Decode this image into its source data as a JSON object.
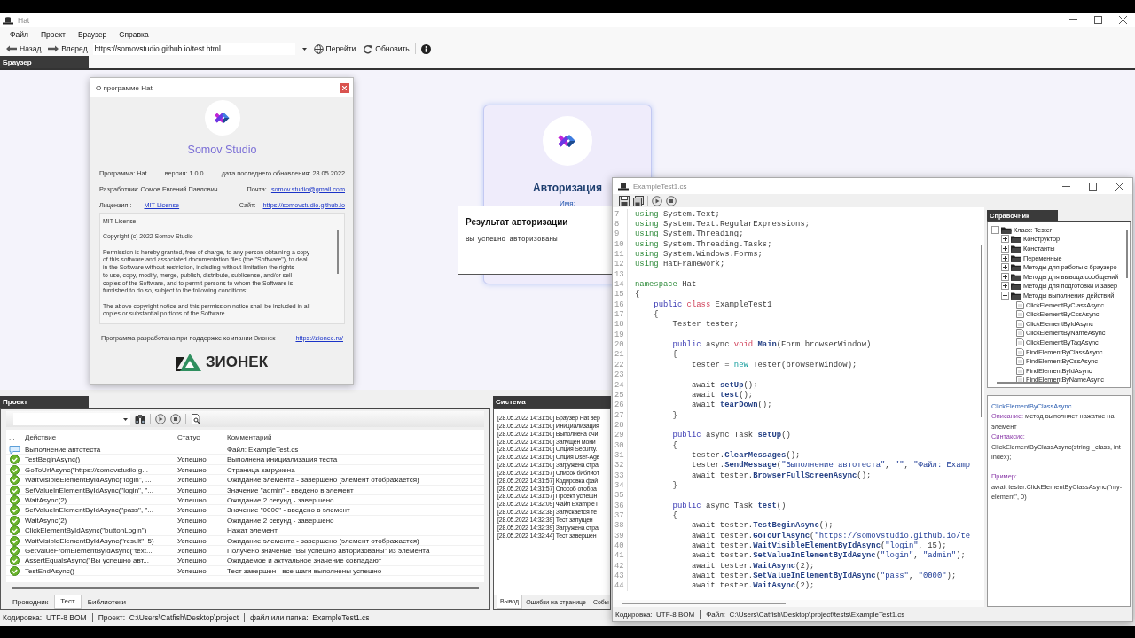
{
  "window": {
    "title": "Hat"
  },
  "menu": [
    "Файл",
    "Проект",
    "Браузер",
    "Справка"
  ],
  "browser_toolbar": {
    "back": "Назад",
    "forward": "Вперед",
    "url": "https://somovstudio.github.io/test.html",
    "go": "Перейти",
    "refresh": "Обновить"
  },
  "browser_tab": "Браузер",
  "web_page": {
    "card_title": "Авторизация",
    "name_label": "Имя:",
    "result_popup": {
      "title": "Результат авторизации",
      "message": "Вы успешно авторизованы"
    }
  },
  "about_dialog": {
    "title": "О программе Hat",
    "studio": "Somov Studio",
    "program": "Программа: Hat",
    "version": "версия: 1.0.0",
    "updated": "дата последнего обновления: 28.05.2022",
    "developer": "Разработчик: Сомов Евгений Павлович",
    "email_label": "Почта:",
    "email": "somov.studio@gmail.com",
    "license_label": "Лицензия :",
    "license": "MIT License",
    "site_label": "Сайт:",
    "site": "https://somovstudio.github.io",
    "license_text": [
      "MIT License",
      "Copyright (c) 2022 Somov Studio",
      "Permission is hereby granted, free of charge, to any person obtaining a copy\nof this software and associated documentation files (the \"Software\"), to deal\nin the Software without restriction, including without limitation the rights\nto use, copy, modify, merge, publish, distribute, sublicense, and/or sell\ncopies of the Software, and to permit persons to whom the Software is\nfurnished to do so, subject to the following conditions:",
      "The above copyright notice and this permission notice shall be included in all\ncopies or substantial portions of the Software."
    ],
    "footer_text": "Программа разработана при поддержке компании Зионек",
    "footer_link": "https://zionec.ru/",
    "sponsor_name": "ЗИОНЕК"
  },
  "project_panel": {
    "title": "Проект",
    "table": {
      "columns": [
        "...",
        "Действие",
        "Статус",
        "Комментарий"
      ],
      "rows": [
        {
          "kind": "message",
          "action": "Выполнение автотеста",
          "comment": "Файл: ExampleTest.cs"
        },
        {
          "kind": "success",
          "action": "TestBeginAsync()",
          "status": "Успешно",
          "comment": "Выполнена инициализация теста"
        },
        {
          "kind": "success",
          "action": "GoToUrlAsync(\"https://somovstudio.g...",
          "status": "Успешно",
          "comment": "Страница загружена"
        },
        {
          "kind": "success",
          "action": "WaitVisibleElementByIdAsync(\"login\", ...",
          "status": "Успешно",
          "comment": "Ожидание элемента - завершено (элемент отображается)"
        },
        {
          "kind": "success",
          "action": "SetValueInElementByIdAsync(\"login\", \"...",
          "status": "Успешно",
          "comment": "Значение \"admin\" - введено в элемент"
        },
        {
          "kind": "success",
          "action": "WaitAsync(2)",
          "status": "Успешно",
          "comment": "Ожидание 2 секунд - завершено"
        },
        {
          "kind": "success",
          "action": "SetValueInElementByIdAsync(\"pass\", \"...",
          "status": "Успешно",
          "comment": "Значение \"0000\" - введено в элемент"
        },
        {
          "kind": "success",
          "action": "WaitAsync(2)",
          "status": "Успешно",
          "comment": "Ожидание 2 секунд - завершено"
        },
        {
          "kind": "success",
          "action": "ClickElementByIdAsync(\"buttonLogin\")",
          "status": "Успешно",
          "comment": "Нажат элемент"
        },
        {
          "kind": "success",
          "action": "WaitVisibleElementByIdAsync(\"result\", 5)",
          "status": "Успешно",
          "comment": "Ожидание элемента - завершено (элемент отображается)"
        },
        {
          "kind": "success",
          "action": "GetValueFromElementByIdAsync(\"text...",
          "status": "Успешно",
          "comment": "Получено значение \"Вы успешно авторизованы\" из элемента"
        },
        {
          "kind": "success",
          "action": "AssertEqualsAsync(\"Вы успешно авт...",
          "status": "Успешно",
          "comment": "Ожидаемое и актуальное значение совпадают"
        },
        {
          "kind": "success",
          "action": "TestEndAsync()",
          "status": "Успешно",
          "comment": "Тест завершен - все шаги выполнены успешно"
        }
      ]
    },
    "tabs": [
      {
        "label": "Проводник",
        "selected": false
      },
      {
        "label": "Тест",
        "selected": true
      },
      {
        "label": "Библиотеки",
        "selected": false
      }
    ]
  },
  "system_panel": {
    "title": "Система",
    "log": [
      "[28.05.2022 14:31:50] Браузер Hat вер",
      "[28.05.2022 14:31:50] Инициализация",
      "[28.05.2022 14:31:50] Выполнена очи",
      "[28.05.2022 14:31:50] Запущен мони",
      "[28.05.2022 14:31:50] Опция Security.",
      "[28.05.2022 14:31:50] Опция User-Age",
      "[28.05.2022 14:31:50] Загружена стра",
      "[28.05.2022 14:31:57] Список библиот",
      "[28.05.2022 14:31:57] Кодировка фай",
      "[28.05.2022 14:31:57] Способ отобра",
      "[28.05.2022 14:31:57] Проект успешн",
      "[28.05.2022 14:32:09] Файл ExampleT",
      "[28.05.2022 14:32:38] Запускается те",
      "[28.05.2022 14:32:39] Тест запущен",
      "[28.05.2022 14:32:39] Загружена стра",
      "[28.05.2022 14:32:44] Тест завершен"
    ],
    "tabs": [
      {
        "label": "Вывод",
        "selected": true
      },
      {
        "label": "Ошибки на странице",
        "selected": false
      },
      {
        "label": "Собы",
        "selected": false
      }
    ]
  },
  "code_window": {
    "title": "ExampleTest1.cs",
    "lines": [
      {
        "number": "7",
        "tokens": [
          {
            "kind": "keyword",
            "text": "using"
          },
          {
            "kind": "text",
            "text": " System.Text;"
          }
        ]
      },
      {
        "number": "8",
        "tokens": [
          {
            "kind": "keyword",
            "text": "using"
          },
          {
            "kind": "text",
            "text": " System.Text.RegularExpressions;"
          }
        ]
      },
      {
        "number": "9",
        "tokens": [
          {
            "kind": "keyword",
            "text": "using"
          },
          {
            "kind": "text",
            "text": " System.Threading;"
          }
        ]
      },
      {
        "number": "10",
        "tokens": [
          {
            "kind": "keyword",
            "text": "using"
          },
          {
            "kind": "text",
            "text": " System.Threading.Tasks;"
          }
        ]
      },
      {
        "number": "11",
        "tokens": [
          {
            "kind": "keyword",
            "text": "using"
          },
          {
            "kind": "text",
            "text": " System.Windows.Forms;"
          }
        ]
      },
      {
        "number": "12",
        "tokens": [
          {
            "kind": "keyword",
            "text": "using"
          },
          {
            "kind": "text",
            "text": " HatFramework;"
          }
        ]
      },
      {
        "number": "13"
      },
      {
        "number": "14",
        "tokens": [
          {
            "kind": "keyword",
            "text": "namespace"
          },
          {
            "kind": "text",
            "text": " Hat"
          }
        ]
      },
      {
        "number": "15",
        "tokens": [
          {
            "kind": "text",
            "text": "{"
          }
        ]
      },
      {
        "number": "16",
        "tokens": [
          {
            "kind": "modifier",
            "text": "    public"
          },
          {
            "kind": "declaration",
            "text": " class"
          },
          {
            "kind": "text",
            "text": " ExampleTest1"
          }
        ]
      },
      {
        "number": "17",
        "tokens": [
          {
            "kind": "text",
            "text": "    {"
          }
        ]
      },
      {
        "number": "18",
        "tokens": [
          {
            "kind": "text",
            "text": "        Tester tester;"
          }
        ]
      },
      {
        "number": "19"
      },
      {
        "number": "20",
        "tokens": [
          {
            "kind": "modifier",
            "text": "        public"
          },
          {
            "kind": "text",
            "text": " async "
          },
          {
            "kind": "declaration",
            "text": "void"
          },
          {
            "kind": "call",
            "text": " Main"
          },
          {
            "kind": "text",
            "text": "(Form browserWindow)"
          }
        ]
      },
      {
        "number": "21",
        "tokens": [
          {
            "kind": "text",
            "text": "        {"
          }
        ]
      },
      {
        "number": "22",
        "tokens": [
          {
            "kind": "text",
            "text": "            tester = "
          },
          {
            "kind": "operator",
            "text": "new"
          },
          {
            "kind": "text",
            "text": " Tester(browserWindow);"
          }
        ]
      },
      {
        "number": "23"
      },
      {
        "number": "24",
        "tokens": [
          {
            "kind": "text",
            "text": "            await "
          },
          {
            "kind": "call",
            "text": "setUp"
          },
          {
            "kind": "text",
            "text": "();"
          }
        ]
      },
      {
        "number": "25",
        "tokens": [
          {
            "kind": "text",
            "text": "            await "
          },
          {
            "kind": "call",
            "text": "test"
          },
          {
            "kind": "text",
            "text": "();"
          }
        ]
      },
      {
        "number": "26",
        "tokens": [
          {
            "kind": "text",
            "text": "            await "
          },
          {
            "kind": "call",
            "text": "tearDown"
          },
          {
            "kind": "text",
            "text": "();"
          }
        ]
      },
      {
        "number": "27",
        "tokens": [
          {
            "kind": "text",
            "text": "        }"
          }
        ]
      },
      {
        "number": "28"
      },
      {
        "number": "29",
        "tokens": [
          {
            "kind": "modifier",
            "text": "        public"
          },
          {
            "kind": "text",
            "text": " async Task "
          },
          {
            "kind": "call",
            "text": "setUp"
          },
          {
            "kind": "text",
            "text": "()"
          }
        ]
      },
      {
        "number": "30",
        "tokens": [
          {
            "kind": "text",
            "text": "        {"
          }
        ]
      },
      {
        "number": "31",
        "tokens": [
          {
            "kind": "text",
            "text": "            tester."
          },
          {
            "kind": "call",
            "text": "ClearMessages"
          },
          {
            "kind": "text",
            "text": "();"
          }
        ]
      },
      {
        "number": "32",
        "tokens": [
          {
            "kind": "text",
            "text": "            tester."
          },
          {
            "kind": "call",
            "text": "SendMessage"
          },
          {
            "kind": "text",
            "text": "("
          },
          {
            "kind": "string",
            "text": "\"Выполнение автотеста\""
          },
          {
            "kind": "text",
            "text": ", "
          },
          {
            "kind": "string",
            "text": "\"\""
          },
          {
            "kind": "text",
            "text": ", "
          },
          {
            "kind": "string",
            "text": "\"Файл: Examp"
          }
        ]
      },
      {
        "number": "33",
        "tokens": [
          {
            "kind": "text",
            "text": "            await tester."
          },
          {
            "kind": "call",
            "text": "BrowserFullScreenAsync"
          },
          {
            "kind": "text",
            "text": "();"
          }
        ]
      },
      {
        "number": "34",
        "tokens": [
          {
            "kind": "text",
            "text": "        }"
          }
        ]
      },
      {
        "number": "35"
      },
      {
        "number": "36",
        "tokens": [
          {
            "kind": "modifier",
            "text": "        public"
          },
          {
            "kind": "text",
            "text": " async Task "
          },
          {
            "kind": "call",
            "text": "test"
          },
          {
            "kind": "text",
            "text": "()"
          }
        ]
      },
      {
        "number": "37",
        "tokens": [
          {
            "kind": "text",
            "text": "        {"
          }
        ]
      },
      {
        "number": "38",
        "tokens": [
          {
            "kind": "text",
            "text": "            await tester."
          },
          {
            "kind": "call",
            "text": "TestBeginAsync"
          },
          {
            "kind": "text",
            "text": "();"
          }
        ]
      },
      {
        "number": "39",
        "tokens": [
          {
            "kind": "text",
            "text": "            await tester."
          },
          {
            "kind": "call",
            "text": "GoToUrlAsync"
          },
          {
            "kind": "text",
            "text": "("
          },
          {
            "kind": "string",
            "text": "\"https://somovstudio.github.io/te"
          }
        ]
      },
      {
        "number": "40",
        "tokens": [
          {
            "kind": "text",
            "text": "            await tester."
          },
          {
            "kind": "call",
            "text": "WaitVisibleElementByIdAsync"
          },
          {
            "kind": "text",
            "text": "("
          },
          {
            "kind": "string",
            "text": "\"login\""
          },
          {
            "kind": "text",
            "text": ", 15);"
          }
        ]
      },
      {
        "number": "41",
        "tokens": [
          {
            "kind": "text",
            "text": "            await tester."
          },
          {
            "kind": "call",
            "text": "SetValueInElementByIdAsync"
          },
          {
            "kind": "text",
            "text": "("
          },
          {
            "kind": "string",
            "text": "\"login\""
          },
          {
            "kind": "text",
            "text": ", "
          },
          {
            "kind": "string",
            "text": "\"admin\""
          },
          {
            "kind": "text",
            "text": ");"
          }
        ]
      },
      {
        "number": "42",
        "tokens": [
          {
            "kind": "text",
            "text": "            await tester."
          },
          {
            "kind": "call",
            "text": "WaitAsync"
          },
          {
            "kind": "text",
            "text": "(2);"
          }
        ]
      },
      {
        "number": "43",
        "tokens": [
          {
            "kind": "text",
            "text": "            await tester."
          },
          {
            "kind": "call",
            "text": "SetValueInElementByIdAsync"
          },
          {
            "kind": "text",
            "text": "("
          },
          {
            "kind": "string",
            "text": "\"pass\""
          },
          {
            "kind": "text",
            "text": ", "
          },
          {
            "kind": "string",
            "text": "\"0000\""
          },
          {
            "kind": "text",
            "text": ");"
          }
        ]
      },
      {
        "number": "44",
        "tokens": [
          {
            "kind": "text",
            "text": "            await tester."
          },
          {
            "kind": "call",
            "text": "WaitAsync"
          },
          {
            "kind": "text",
            "text": "(2);"
          }
        ]
      }
    ],
    "reference": {
      "title": "Справочник",
      "tree": [
        {
          "kind": "folder",
          "label": "Класс: Tester",
          "expanded": true,
          "children": [
            {
              "kind": "folder",
              "label": "Конструктор",
              "expanded": false
            },
            {
              "kind": "folder",
              "label": "Константы",
              "expanded": false
            },
            {
              "kind": "folder",
              "label": "Переменные",
              "expanded": false
            },
            {
              "kind": "folder",
              "label": "Методы для работы с браузеро",
              "expanded": false
            },
            {
              "kind": "folder",
              "label": "Методы для вывода сообщений",
              "expanded": false
            },
            {
              "kind": "folder",
              "label": "Методы для подготовки и завер",
              "expanded": false
            },
            {
              "kind": "folder",
              "label": "Методы выполнения действий",
              "expanded": true,
              "children": [
                {
                  "kind": "method",
                  "label": "ClickElementByClassAsync"
                },
                {
                  "kind": "method",
                  "label": "ClickElementByCssAsync"
                },
                {
                  "kind": "method",
                  "label": "ClickElementByIdAsync"
                },
                {
                  "kind": "method",
                  "label": "ClickElementByNameAsync"
                },
                {
                  "kind": "method",
                  "label": "ClickElementByTagAsync"
                },
                {
                  "kind": "method",
                  "label": "FindElementByClassAsync"
                },
                {
                  "kind": "method",
                  "label": "FindElementByCssAsync"
                },
                {
                  "kind": "method",
                  "label": "FindElementByIdAsync"
                },
                {
                  "kind": "method",
                  "label": "FindElementByNameAsync"
                }
              ]
            }
          ]
        }
      ],
      "description": {
        "title": "ClickElementByClassAsync",
        "fields": [
          {
            "kind": "inline",
            "label": "Описание:",
            "text": "метод выполняет нажатие на элемент"
          },
          {
            "kind": "block",
            "label": "Синтаксис:",
            "text": "ClickElementByClassAsync(string _class, int index);"
          },
          {
            "kind": "example",
            "label": "Пример:",
            "text": "await tester.ClickElementByClassAsync(\"my-element\", 0)"
          }
        ]
      }
    },
    "status_bar": [
      "Кодировка:  UTF-8 BOM",
      "Файл:  C:\\Users\\Catfish\\Desktop\\project\\tests\\ExampleTest1.cs"
    ]
  },
  "status_bar": [
    "Кодировка:  UTF-8 BOM",
    "Проект:  C:\\Users\\Catfish\\Desktop\\project",
    "файл или папка:  ExampleTest1.cs"
  ]
}
